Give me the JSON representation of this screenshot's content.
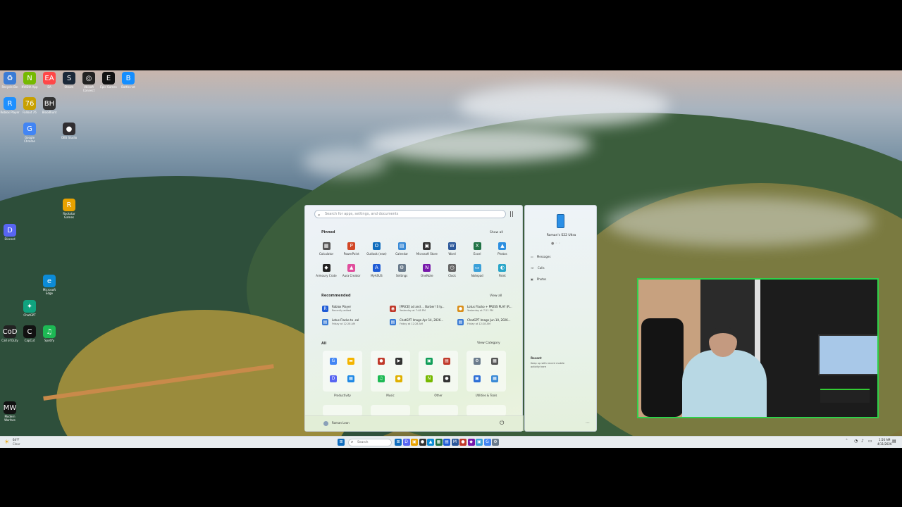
{
  "desktop": {
    "icons": [
      {
        "label": "Recycle Bin",
        "color": "#3a7bd5",
        "glyph": "♻"
      },
      {
        "label": "NVIDIA App",
        "color": "#76b900",
        "glyph": "N"
      },
      {
        "label": "EA",
        "color": "#ff4747",
        "glyph": "EA"
      },
      {
        "label": "Steam",
        "color": "#1b2838",
        "glyph": "S"
      },
      {
        "label": "Ubisoft Connect",
        "color": "#222",
        "glyph": "◎"
      },
      {
        "label": "Epic Games",
        "color": "#111",
        "glyph": "E"
      },
      {
        "label": "Battle.net",
        "color": "#148eff",
        "glyph": "B"
      },
      {
        "label": "Roblox Player",
        "color": "#1e90ff",
        "glyph": "R"
      },
      {
        "label": "Fallout 76",
        "color": "#c8a000",
        "glyph": "76"
      },
      {
        "label": "Bloodhunt",
        "color": "#333",
        "glyph": "BH"
      },
      {
        "label": "Google Chrome",
        "color": "#4285f4",
        "glyph": "G"
      },
      {
        "label": "Discord",
        "color": "#5865f2",
        "glyph": "D"
      },
      {
        "label": "OBS Studio",
        "color": "#302e31",
        "glyph": "●"
      },
      {
        "label": "Microsoft Edge",
        "color": "#0c8bd6",
        "glyph": "e"
      },
      {
        "label": "Call of Duty",
        "color": "#222",
        "glyph": "CoD"
      },
      {
        "label": "CapCut",
        "color": "#111",
        "glyph": "C"
      },
      {
        "label": "ChatGPT",
        "color": "#10a37f",
        "glyph": "✦"
      },
      {
        "label": "Rockstar Games Launcher",
        "color": "#e8a200",
        "glyph": "R"
      },
      {
        "label": "Spotify",
        "color": "#1db954",
        "glyph": "♫"
      },
      {
        "label": "Modern Warfare",
        "color": "#111",
        "glyph": "MW"
      }
    ]
  },
  "start_menu": {
    "search_placeholder": "Search for apps, settings, and documents",
    "pinned_title": "Pinned",
    "show_all": "Show all",
    "pinned": [
      {
        "label": "Calculator",
        "color": "#555",
        "glyph": "▦"
      },
      {
        "label": "PowerPoint",
        "color": "#d24726",
        "glyph": "P"
      },
      {
        "label": "Outlook (new)",
        "color": "#0f6cbd",
        "glyph": "O"
      },
      {
        "label": "Calendar",
        "color": "#3a8ad6",
        "glyph": "▤"
      },
      {
        "label": "Microsoft Store",
        "color": "#333",
        "glyph": "▣"
      },
      {
        "label": "Word",
        "color": "#2b579a",
        "glyph": "W"
      },
      {
        "label": "Excel",
        "color": "#217346",
        "glyph": "X"
      },
      {
        "label": "Photos",
        "color": "#2d8fe0",
        "glyph": "▲"
      },
      {
        "label": "Armoury Crate",
        "color": "#222",
        "glyph": "◆"
      },
      {
        "label": "Aura Creator",
        "color": "#e04e9d",
        "glyph": "▲"
      },
      {
        "label": "MyASUS",
        "color": "#1e5bd6",
        "glyph": "A"
      },
      {
        "label": "Settings",
        "color": "#6a7b8c",
        "glyph": "⚙"
      },
      {
        "label": "OneNote",
        "color": "#7719aa",
        "glyph": "N"
      },
      {
        "label": "Clock",
        "color": "#666",
        "glyph": "◷"
      },
      {
        "label": "Notepad",
        "color": "#3aa0d9",
        "glyph": "▭"
      },
      {
        "label": "Paint",
        "color": "#2aa6c9",
        "glyph": "◐"
      }
    ],
    "recommended_title": "Recommended",
    "show_all_rec": "View all",
    "recommended": [
      {
        "title": "Roblox Player",
        "sub": "Recently added",
        "color": "#1e5bd6",
        "glyph": "R"
      },
      {
        "title": "[PRICE] ad and ... Barber  !S ty...",
        "sub": "Yesterday at 7:48 PM",
        "color": "#c0392b",
        "glyph": "◉"
      },
      {
        "title": "Lotus Flacko + PRESS PLAY (R...",
        "sub": "Yesterday at 7:21 PM",
        "color": "#d98e1a",
        "glyph": "●"
      },
      {
        "title": "Lotus Flacko to .cal",
        "sub": "Friday at 12:28 AM",
        "color": "#3a7bd5",
        "glyph": "▤"
      },
      {
        "title": "ChatGPT Image Apr 14, 2026...",
        "sub": "Friday at 12:28 AM",
        "color": "#3a7bd5",
        "glyph": "▤"
      },
      {
        "title": "ChatGPT Image Jun 10, 2026...",
        "sub": "Friday at 12:28 AM",
        "color": "#3a7bd5",
        "glyph": "▤"
      }
    ],
    "all_title": "All",
    "view_category": "View Category",
    "categories": [
      {
        "label": "Productivity",
        "glyphs": [
          [
            "#4285f4",
            "G"
          ],
          [
            "#f4b400",
            "▬"
          ],
          [
            "#5865f2",
            "D"
          ],
          [
            "#1e88e5",
            "▦"
          ]
        ]
      },
      {
        "label": "Music",
        "glyphs": [
          [
            "#c0392b",
            "●"
          ],
          [
            "#333",
            "▶"
          ],
          [
            "#1db954",
            "♫"
          ],
          [
            "#e0b000",
            "●"
          ]
        ]
      },
      {
        "label": "Other",
        "glyphs": [
          [
            "#0f9d58",
            "▣"
          ],
          [
            "#c0392b",
            "▤"
          ],
          [
            "#76b900",
            "N"
          ],
          [
            "#333",
            "●"
          ]
        ]
      },
      {
        "label": "Utilities & Tools",
        "glyphs": [
          [
            "#6a7b8c",
            "⚙"
          ],
          [
            "#555",
            "▦"
          ],
          [
            "#2d6fd6",
            "▣"
          ],
          [
            "#3a8ad6",
            "▦"
          ]
        ]
      }
    ],
    "user_name": "Roman Leon",
    "power_icon": "power-icon"
  },
  "phone_link": {
    "device_name": "Roman's S22 Ultra",
    "items": [
      "Messages",
      "Calls",
      "Photos"
    ],
    "recent_title": "Recent",
    "recent_text": "Keep up with recent mobile activity here"
  },
  "taskbar": {
    "weather_temp": "64°F",
    "weather_desc": "Clear",
    "search_label": "Search",
    "time": "1:56 AM",
    "date": "4/11/2026",
    "apps": [
      [
        "#0f6cbd",
        "⊞"
      ],
      [
        "#5865f2",
        "D"
      ],
      [
        "#e8a200",
        "▣"
      ],
      [
        "#333",
        "●"
      ],
      [
        "#0c8bd6",
        "▲"
      ],
      [
        "#217346",
        "▦"
      ],
      [
        "#1e5bd6",
        "▤"
      ],
      [
        "#2b579a",
        "M"
      ],
      [
        "#c0392b",
        "●"
      ],
      [
        "#7719aa",
        "◆"
      ],
      [
        "#3aa0d9",
        "▣"
      ],
      [
        "#4285f4",
        "G"
      ],
      [
        "#6a7b8c",
        "⚙"
      ]
    ]
  }
}
